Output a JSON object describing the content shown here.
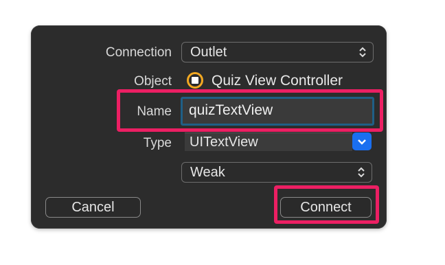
{
  "labels": {
    "connection": "Connection",
    "object": "Object",
    "name": "Name",
    "type": "Type"
  },
  "connection": {
    "value": "Outlet"
  },
  "object": {
    "value": "Quiz View Controller",
    "icon": "view-controller-icon"
  },
  "name": {
    "value": "quizTextView"
  },
  "type": {
    "value": "UITextView"
  },
  "storage": {
    "value": "Weak"
  },
  "buttons": {
    "cancel": "Cancel",
    "connect": "Connect"
  },
  "colors": {
    "highlight": "#ec1f63",
    "accent": "#1a6ff0",
    "object_icon": "#f3a922",
    "dialog_bg": "#2c2c2c"
  }
}
